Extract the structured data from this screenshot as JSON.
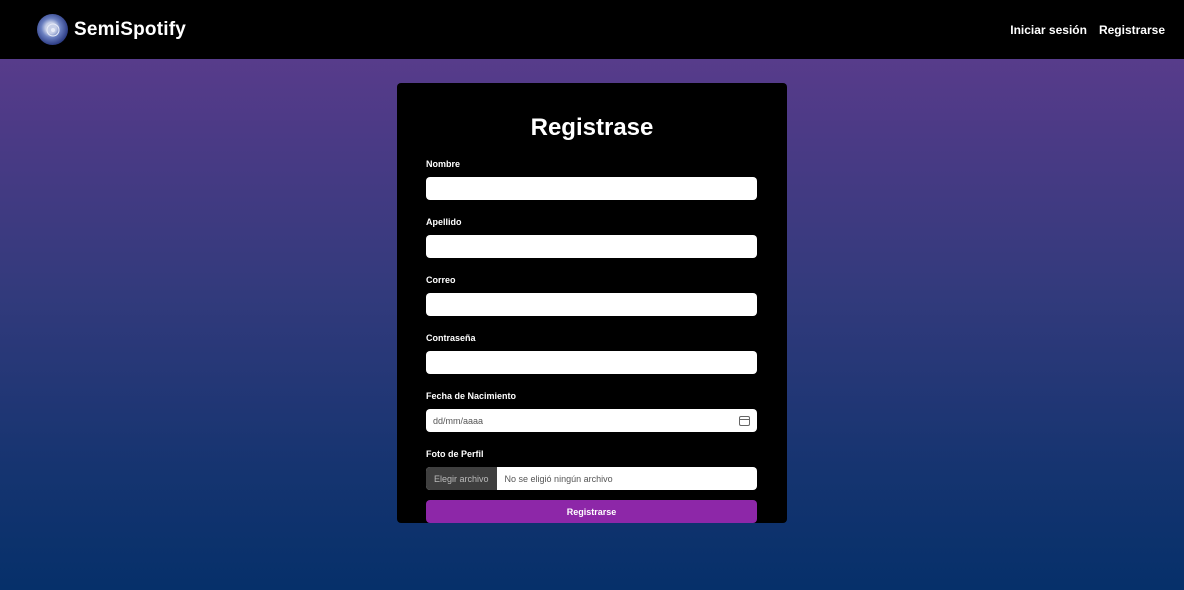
{
  "navbar": {
    "brand": "SemiSpotify",
    "logo_icon": "vinyl-logo-icon",
    "links": [
      "Iniciar sesión",
      "Registrarse"
    ]
  },
  "form": {
    "title": "Registrase",
    "fields": {
      "nombre": {
        "label": "Nombre",
        "value": ""
      },
      "apellido": {
        "label": "Apellido",
        "value": ""
      },
      "correo": {
        "label": "Correo",
        "value": ""
      },
      "contrasena": {
        "label": "Contraseña",
        "value": ""
      },
      "fecha": {
        "label": "Fecha de Nacimiento",
        "placeholder": "dd/mm/aaaa"
      },
      "foto": {
        "label": "Foto de Perfil",
        "button": "Elegir archivo",
        "status": "No se eligió ningún archivo"
      }
    },
    "submit_label": "Registrarse"
  },
  "colors": {
    "navbar": "#000000",
    "card": "#000000",
    "accent": "#8d27a8",
    "gradient_top": "#613d8f",
    "gradient_bottom": "#06306a"
  }
}
